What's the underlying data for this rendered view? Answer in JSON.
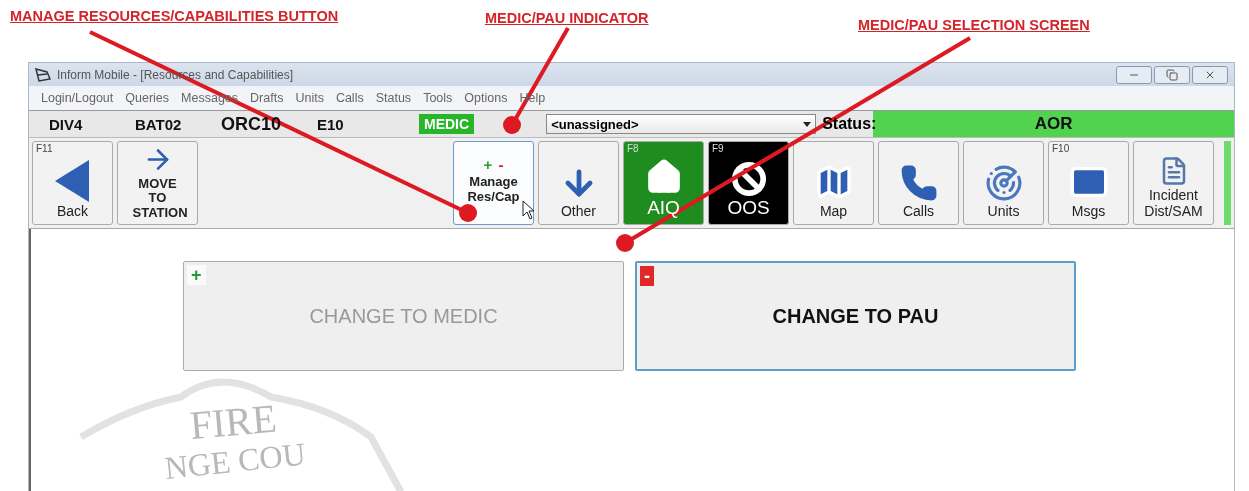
{
  "annotations": [
    {
      "text": "MANAGE RESOURCES/CAPABILITIES BUTTON"
    },
    {
      "text": "MEDIC/PAU INDICATOR"
    },
    {
      "text": "MEDIC/PAU SELECTION SCREEN"
    }
  ],
  "window": {
    "title": "Inform Mobile - [Resources and Capabilities]"
  },
  "menu": [
    "Login/Logout",
    "Queries",
    "Messages",
    "Drafts",
    "Units",
    "Calls",
    "Status",
    "Tools",
    "Options",
    "Help"
  ],
  "unit_bar": {
    "units": [
      "DIV4",
      "BAT02",
      "ORC10",
      "E10"
    ],
    "capability": "MEDIC",
    "assignment": "<unassigned>",
    "status_label": "Status:",
    "status": "AOR"
  },
  "toolbar_left": [
    {
      "kind": "plain",
      "label": "Back",
      "hotkey": "F11",
      "selected": false
    },
    {
      "kind": "bold",
      "label": "MOVE TO STATION",
      "selected": false
    }
  ],
  "toolbar_right": [
    {
      "kind": "bold",
      "label": "Manage Res/Cap",
      "marks": [
        "+",
        "-"
      ],
      "selected": true
    },
    {
      "kind": "plain",
      "label": "Other",
      "selected": false
    },
    {
      "kind": "status",
      "label": "AIQ",
      "hotkey": "F8",
      "color": "#1e8c1e",
      "selected": false
    },
    {
      "kind": "status",
      "label": "OOS",
      "hotkey": "F9",
      "color": "#000000",
      "selected": false
    },
    {
      "kind": "plain",
      "label": "Map",
      "selected": false
    },
    {
      "kind": "plain",
      "label": "Calls",
      "selected": false
    },
    {
      "kind": "plain",
      "label": "Units",
      "selected": false
    },
    {
      "kind": "plain",
      "label": "Msgs",
      "hotkey": "F10",
      "selected": false
    },
    {
      "kind": "plain",
      "label": "Incident Dist/SAM",
      "selected": false
    }
  ],
  "options": [
    {
      "kind": "add",
      "sign": "+",
      "label": "CHANGE TO MEDIC",
      "disabled": true
    },
    {
      "kind": "remove",
      "sign": "-",
      "label": "CHANGE TO PAU",
      "disabled": false
    }
  ],
  "emblem": {
    "top": "FIRE",
    "bottom": "NGE COU"
  }
}
